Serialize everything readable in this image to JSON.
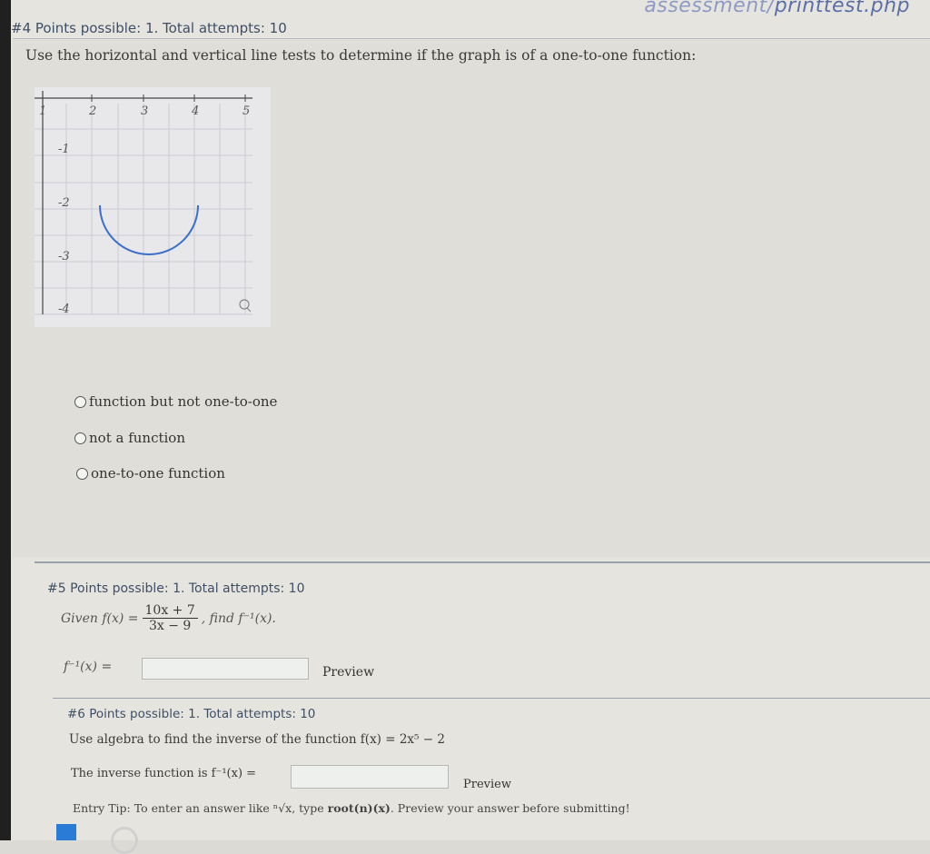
{
  "url": {
    "faded": "assessment/",
    "main": "printtest.php"
  },
  "q4": {
    "header": "#4 Points possible: 1. Total attempts: 10",
    "prompt": "Use the horizontal and vertical line tests to determine if the graph is of a one-to-one function:",
    "graph": {
      "x_ticks": [
        "1",
        "2",
        "3",
        "4",
        "5"
      ],
      "y_ticks": [
        "-1",
        "-2",
        "-3",
        "-4"
      ],
      "curve_color": "#3b6fc9"
    },
    "options": [
      "function but not one-to-one",
      "not a function",
      "one-to-one function"
    ]
  },
  "q5": {
    "header": "#5 Points possible: 1. Total attempts: 10",
    "given_prefix": "Given f(x) =",
    "numerator": "10x + 7",
    "denominator": "3x − 9",
    "find_suffix": ", find f⁻¹(x).",
    "answer_label": "f⁻¹(x) =",
    "preview": "Preview"
  },
  "q6": {
    "header": "#6 Points possible: 1. Total attempts: 10",
    "prompt": "Use algebra to find the inverse of the function f(x) = 2x⁵ − 2",
    "answer_label": "The inverse function is f⁻¹(x) =",
    "preview": "Preview",
    "entry_tip_prefix": "Entry Tip: To enter an answer like ⁿ√x, type ",
    "entry_tip_code": "root(n)(x)",
    "entry_tip_suffix": ". Preview your answer before submitting!"
  }
}
